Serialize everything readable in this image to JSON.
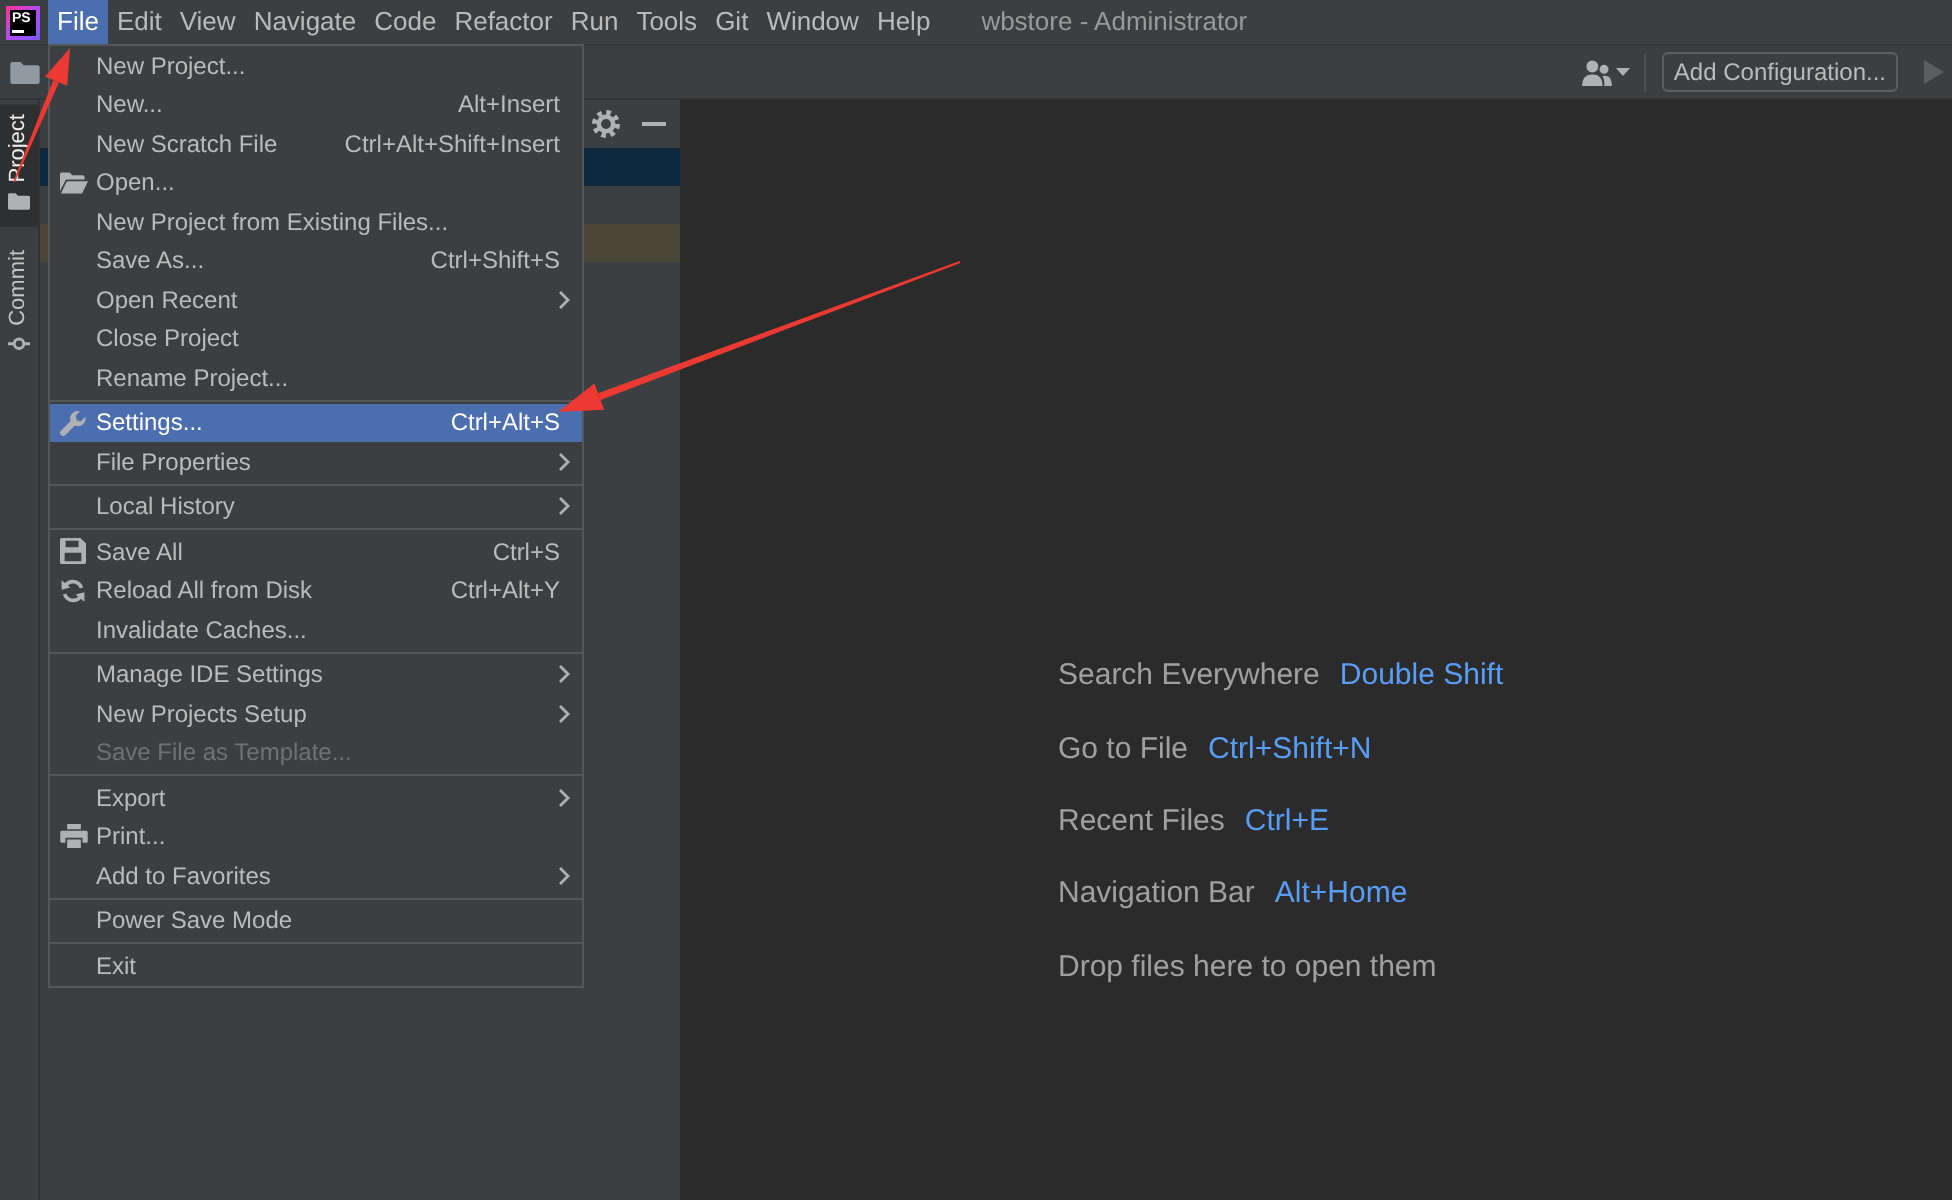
{
  "app_logo": {
    "text": "PS"
  },
  "menu_bar": [
    {
      "label": "File",
      "selected": true
    },
    {
      "label": "Edit",
      "selected": false
    },
    {
      "label": "View",
      "selected": false
    },
    {
      "label": "Navigate",
      "selected": false
    },
    {
      "label": "Code",
      "selected": false
    },
    {
      "label": "Refactor",
      "selected": false
    },
    {
      "label": "Run",
      "selected": false
    },
    {
      "label": "Tools",
      "selected": false
    },
    {
      "label": "Git",
      "selected": false
    },
    {
      "label": "Window",
      "selected": false
    },
    {
      "label": "Help",
      "selected": false
    }
  ],
  "window": {
    "title": "wbstore - Administrator"
  },
  "toolbar": {
    "run_configuration": {
      "label": "Add Configuration..."
    },
    "run_button": {
      "disabled": true
    }
  },
  "tool_window_tabs": [
    {
      "label": "Project",
      "selected": true
    },
    {
      "label": "Commit",
      "selected": false
    }
  ],
  "project_tree": {
    "rows": [
      {
        "selected": true
      },
      {
        "selected": false,
        "color": "#4a4637"
      }
    ]
  },
  "file_menu": {
    "groups": [
      [
        {
          "label": "New Project...",
          "submenu": false,
          "selected": false,
          "disabled": false
        },
        {
          "label": "New...",
          "shortcut": "Alt+Insert",
          "submenu": false,
          "selected": false,
          "disabled": false
        },
        {
          "label": "New Scratch File",
          "shortcut": "Ctrl+Alt+Shift+Insert",
          "submenu": false,
          "selected": false,
          "disabled": false
        },
        {
          "label": "Open...",
          "submenu": false,
          "selected": false,
          "disabled": false
        },
        {
          "label": "New Project from Existing Files...",
          "submenu": false,
          "selected": false,
          "disabled": false
        },
        {
          "label": "Save As...",
          "shortcut": "Ctrl+Shift+S",
          "submenu": false,
          "selected": false,
          "disabled": false
        },
        {
          "label": "Open Recent",
          "submenu": true,
          "selected": false,
          "disabled": false
        },
        {
          "label": "Close Project",
          "submenu": false,
          "selected": false,
          "disabled": false
        },
        {
          "label": "Rename Project...",
          "submenu": false,
          "selected": false,
          "disabled": false
        }
      ],
      [
        {
          "label": "Settings...",
          "shortcut": "Ctrl+Alt+S",
          "submenu": false,
          "selected": true,
          "disabled": false
        },
        {
          "label": "File Properties",
          "submenu": true,
          "selected": false,
          "disabled": false
        }
      ],
      [
        {
          "label": "Local History",
          "submenu": true,
          "selected": false,
          "disabled": false
        }
      ],
      [
        {
          "label": "Save All",
          "shortcut": "Ctrl+S",
          "submenu": false,
          "selected": false,
          "disabled": false
        },
        {
          "label": "Reload All from Disk",
          "shortcut": "Ctrl+Alt+Y",
          "submenu": false,
          "selected": false,
          "disabled": false
        },
        {
          "label": "Invalidate Caches...",
          "submenu": false,
          "selected": false,
          "disabled": false
        }
      ],
      [
        {
          "label": "Manage IDE Settings",
          "submenu": true,
          "selected": false,
          "disabled": false
        },
        {
          "label": "New Projects Setup",
          "submenu": true,
          "selected": false,
          "disabled": false
        },
        {
          "label": "Save File as Template...",
          "submenu": false,
          "selected": false,
          "disabled": true
        }
      ],
      [
        {
          "label": "Export",
          "submenu": true,
          "selected": false,
          "disabled": false
        },
        {
          "label": "Print...",
          "submenu": false,
          "selected": false,
          "disabled": false
        },
        {
          "label": "Add to Favorites",
          "submenu": true,
          "selected": false,
          "disabled": false
        }
      ],
      [
        {
          "label": "Power Save Mode",
          "submenu": false,
          "selected": false,
          "disabled": false
        }
      ],
      [
        {
          "label": "Exit",
          "submenu": false,
          "selected": false,
          "disabled": false
        }
      ]
    ]
  },
  "editor_hints": [
    {
      "action": "Search Everywhere",
      "shortcut": "Double Shift"
    },
    {
      "action": "Go to File",
      "shortcut": "Ctrl+Shift+N"
    },
    {
      "action": "Recent Files",
      "shortcut": "Ctrl+E"
    },
    {
      "action": "Navigation Bar",
      "shortcut": "Alt+Home"
    },
    {
      "action": "Drop files here to open them"
    }
  ]
}
